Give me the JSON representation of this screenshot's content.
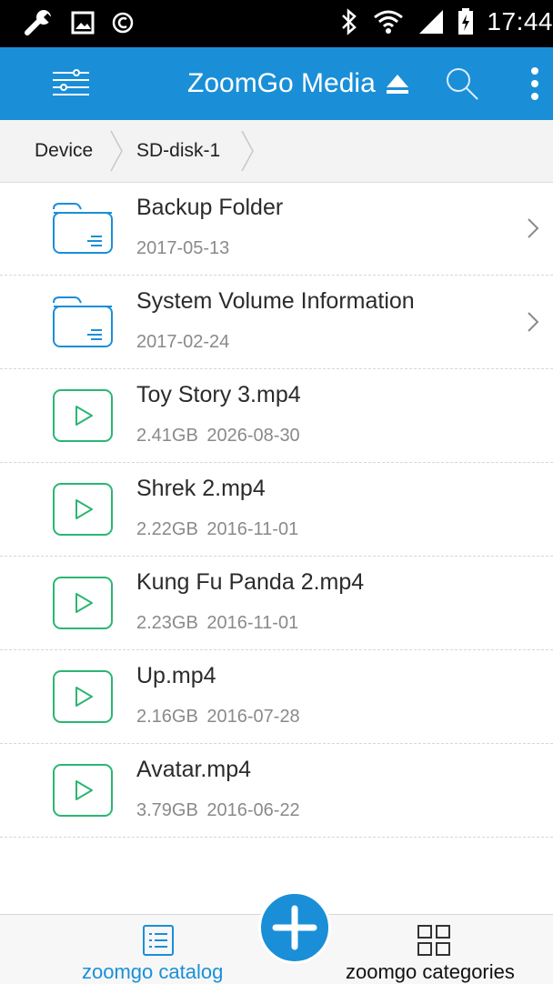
{
  "status_bar": {
    "time": "17:44",
    "left_icons": [
      "wrench-icon",
      "image-icon",
      "copyright-icon"
    ],
    "right_icons": [
      "bluetooth-icon",
      "wifi-icon",
      "signal-icon",
      "battery-icon"
    ]
  },
  "app_bar": {
    "title": "ZoomGo Media",
    "eject_icon": "eject-icon",
    "color": "#1a8fd8"
  },
  "breadcrumb": {
    "items": [
      "Device",
      "SD-disk-1"
    ]
  },
  "files": [
    {
      "type": "folder",
      "name": "Backup Folder",
      "meta": "2017-05-13"
    },
    {
      "type": "folder",
      "name": "System Volume Information",
      "meta": "2017-02-24"
    },
    {
      "type": "video",
      "name": "Toy Story 3.mp4",
      "meta": "2.41GB  2026-08-30"
    },
    {
      "type": "video",
      "name": "Shrek 2.mp4",
      "meta": "2.22GB  2016-11-01"
    },
    {
      "type": "video",
      "name": "Kung Fu Panda 2.mp4",
      "meta": "2.23GB  2016-11-01"
    },
    {
      "type": "video",
      "name": "Up.mp4",
      "meta": "2.16GB  2016-07-28"
    },
    {
      "type": "video",
      "name": "Avatar.mp4",
      "meta": "3.79GB  2016-06-22"
    }
  ],
  "bottom_bar": {
    "catalog_label": "zoomgo catalog",
    "categories_label": "zoomgo categories",
    "active_color": "#1a8fd8"
  }
}
